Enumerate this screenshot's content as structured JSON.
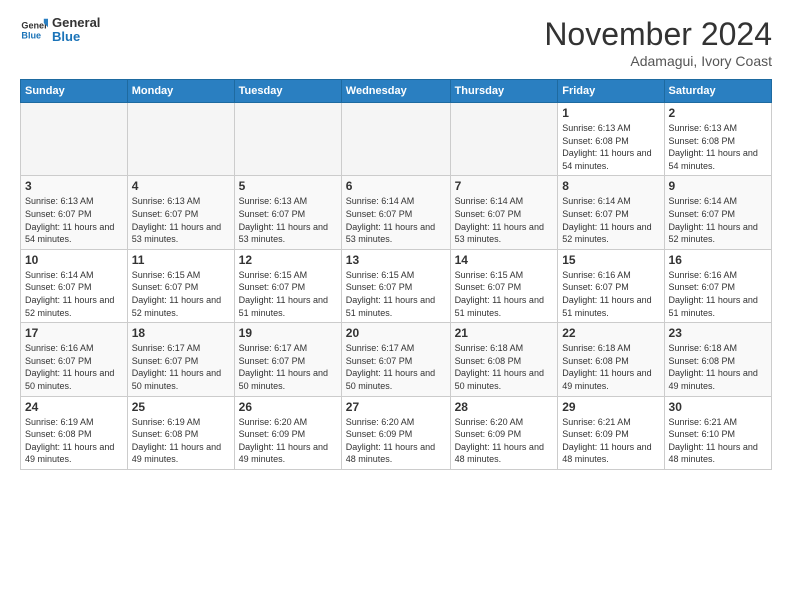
{
  "header": {
    "logo_general": "General",
    "logo_blue": "Blue",
    "month": "November 2024",
    "location": "Adamagui, Ivory Coast"
  },
  "days_of_week": [
    "Sunday",
    "Monday",
    "Tuesday",
    "Wednesday",
    "Thursday",
    "Friday",
    "Saturday"
  ],
  "weeks": [
    [
      {
        "day": "",
        "info": ""
      },
      {
        "day": "",
        "info": ""
      },
      {
        "day": "",
        "info": ""
      },
      {
        "day": "",
        "info": ""
      },
      {
        "day": "",
        "info": ""
      },
      {
        "day": "1",
        "info": "Sunrise: 6:13 AM\nSunset: 6:08 PM\nDaylight: 11 hours and 54 minutes."
      },
      {
        "day": "2",
        "info": "Sunrise: 6:13 AM\nSunset: 6:08 PM\nDaylight: 11 hours and 54 minutes."
      }
    ],
    [
      {
        "day": "3",
        "info": "Sunrise: 6:13 AM\nSunset: 6:07 PM\nDaylight: 11 hours and 54 minutes."
      },
      {
        "day": "4",
        "info": "Sunrise: 6:13 AM\nSunset: 6:07 PM\nDaylight: 11 hours and 53 minutes."
      },
      {
        "day": "5",
        "info": "Sunrise: 6:13 AM\nSunset: 6:07 PM\nDaylight: 11 hours and 53 minutes."
      },
      {
        "day": "6",
        "info": "Sunrise: 6:14 AM\nSunset: 6:07 PM\nDaylight: 11 hours and 53 minutes."
      },
      {
        "day": "7",
        "info": "Sunrise: 6:14 AM\nSunset: 6:07 PM\nDaylight: 11 hours and 53 minutes."
      },
      {
        "day": "8",
        "info": "Sunrise: 6:14 AM\nSunset: 6:07 PM\nDaylight: 11 hours and 52 minutes."
      },
      {
        "day": "9",
        "info": "Sunrise: 6:14 AM\nSunset: 6:07 PM\nDaylight: 11 hours and 52 minutes."
      }
    ],
    [
      {
        "day": "10",
        "info": "Sunrise: 6:14 AM\nSunset: 6:07 PM\nDaylight: 11 hours and 52 minutes."
      },
      {
        "day": "11",
        "info": "Sunrise: 6:15 AM\nSunset: 6:07 PM\nDaylight: 11 hours and 52 minutes."
      },
      {
        "day": "12",
        "info": "Sunrise: 6:15 AM\nSunset: 6:07 PM\nDaylight: 11 hours and 51 minutes."
      },
      {
        "day": "13",
        "info": "Sunrise: 6:15 AM\nSunset: 6:07 PM\nDaylight: 11 hours and 51 minutes."
      },
      {
        "day": "14",
        "info": "Sunrise: 6:15 AM\nSunset: 6:07 PM\nDaylight: 11 hours and 51 minutes."
      },
      {
        "day": "15",
        "info": "Sunrise: 6:16 AM\nSunset: 6:07 PM\nDaylight: 11 hours and 51 minutes."
      },
      {
        "day": "16",
        "info": "Sunrise: 6:16 AM\nSunset: 6:07 PM\nDaylight: 11 hours and 51 minutes."
      }
    ],
    [
      {
        "day": "17",
        "info": "Sunrise: 6:16 AM\nSunset: 6:07 PM\nDaylight: 11 hours and 50 minutes."
      },
      {
        "day": "18",
        "info": "Sunrise: 6:17 AM\nSunset: 6:07 PM\nDaylight: 11 hours and 50 minutes."
      },
      {
        "day": "19",
        "info": "Sunrise: 6:17 AM\nSunset: 6:07 PM\nDaylight: 11 hours and 50 minutes."
      },
      {
        "day": "20",
        "info": "Sunrise: 6:17 AM\nSunset: 6:07 PM\nDaylight: 11 hours and 50 minutes."
      },
      {
        "day": "21",
        "info": "Sunrise: 6:18 AM\nSunset: 6:08 PM\nDaylight: 11 hours and 50 minutes."
      },
      {
        "day": "22",
        "info": "Sunrise: 6:18 AM\nSunset: 6:08 PM\nDaylight: 11 hours and 49 minutes."
      },
      {
        "day": "23",
        "info": "Sunrise: 6:18 AM\nSunset: 6:08 PM\nDaylight: 11 hours and 49 minutes."
      }
    ],
    [
      {
        "day": "24",
        "info": "Sunrise: 6:19 AM\nSunset: 6:08 PM\nDaylight: 11 hours and 49 minutes."
      },
      {
        "day": "25",
        "info": "Sunrise: 6:19 AM\nSunset: 6:08 PM\nDaylight: 11 hours and 49 minutes."
      },
      {
        "day": "26",
        "info": "Sunrise: 6:20 AM\nSunset: 6:09 PM\nDaylight: 11 hours and 49 minutes."
      },
      {
        "day": "27",
        "info": "Sunrise: 6:20 AM\nSunset: 6:09 PM\nDaylight: 11 hours and 48 minutes."
      },
      {
        "day": "28",
        "info": "Sunrise: 6:20 AM\nSunset: 6:09 PM\nDaylight: 11 hours and 48 minutes."
      },
      {
        "day": "29",
        "info": "Sunrise: 6:21 AM\nSunset: 6:09 PM\nDaylight: 11 hours and 48 minutes."
      },
      {
        "day": "30",
        "info": "Sunrise: 6:21 AM\nSunset: 6:10 PM\nDaylight: 11 hours and 48 minutes."
      }
    ]
  ]
}
